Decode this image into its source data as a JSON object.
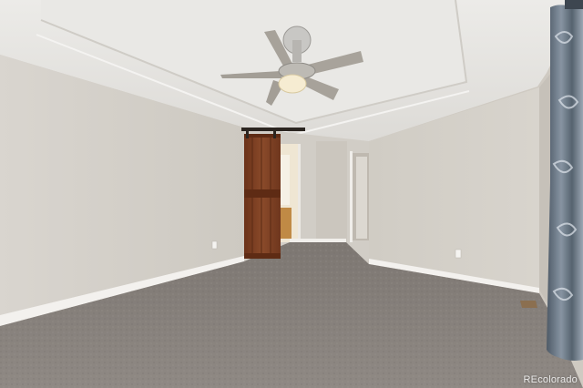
{
  "watermark": "REcolorado",
  "colors": {
    "ceiling": "#e6e4e0",
    "wall_left": "#d6d2cb",
    "wall_back": "#d1cdc6",
    "wall_right": "#d4d0c9",
    "carpet": "#8a8480",
    "barn_door": "#7a3e22",
    "baseboard": "#f3f1ee",
    "curtain": "#5d6a78"
  },
  "icons": [
    "ceiling-fan-icon",
    "barn-door-icon",
    "curtain-icon",
    "outlet-icon",
    "floor-vent-icon"
  ]
}
